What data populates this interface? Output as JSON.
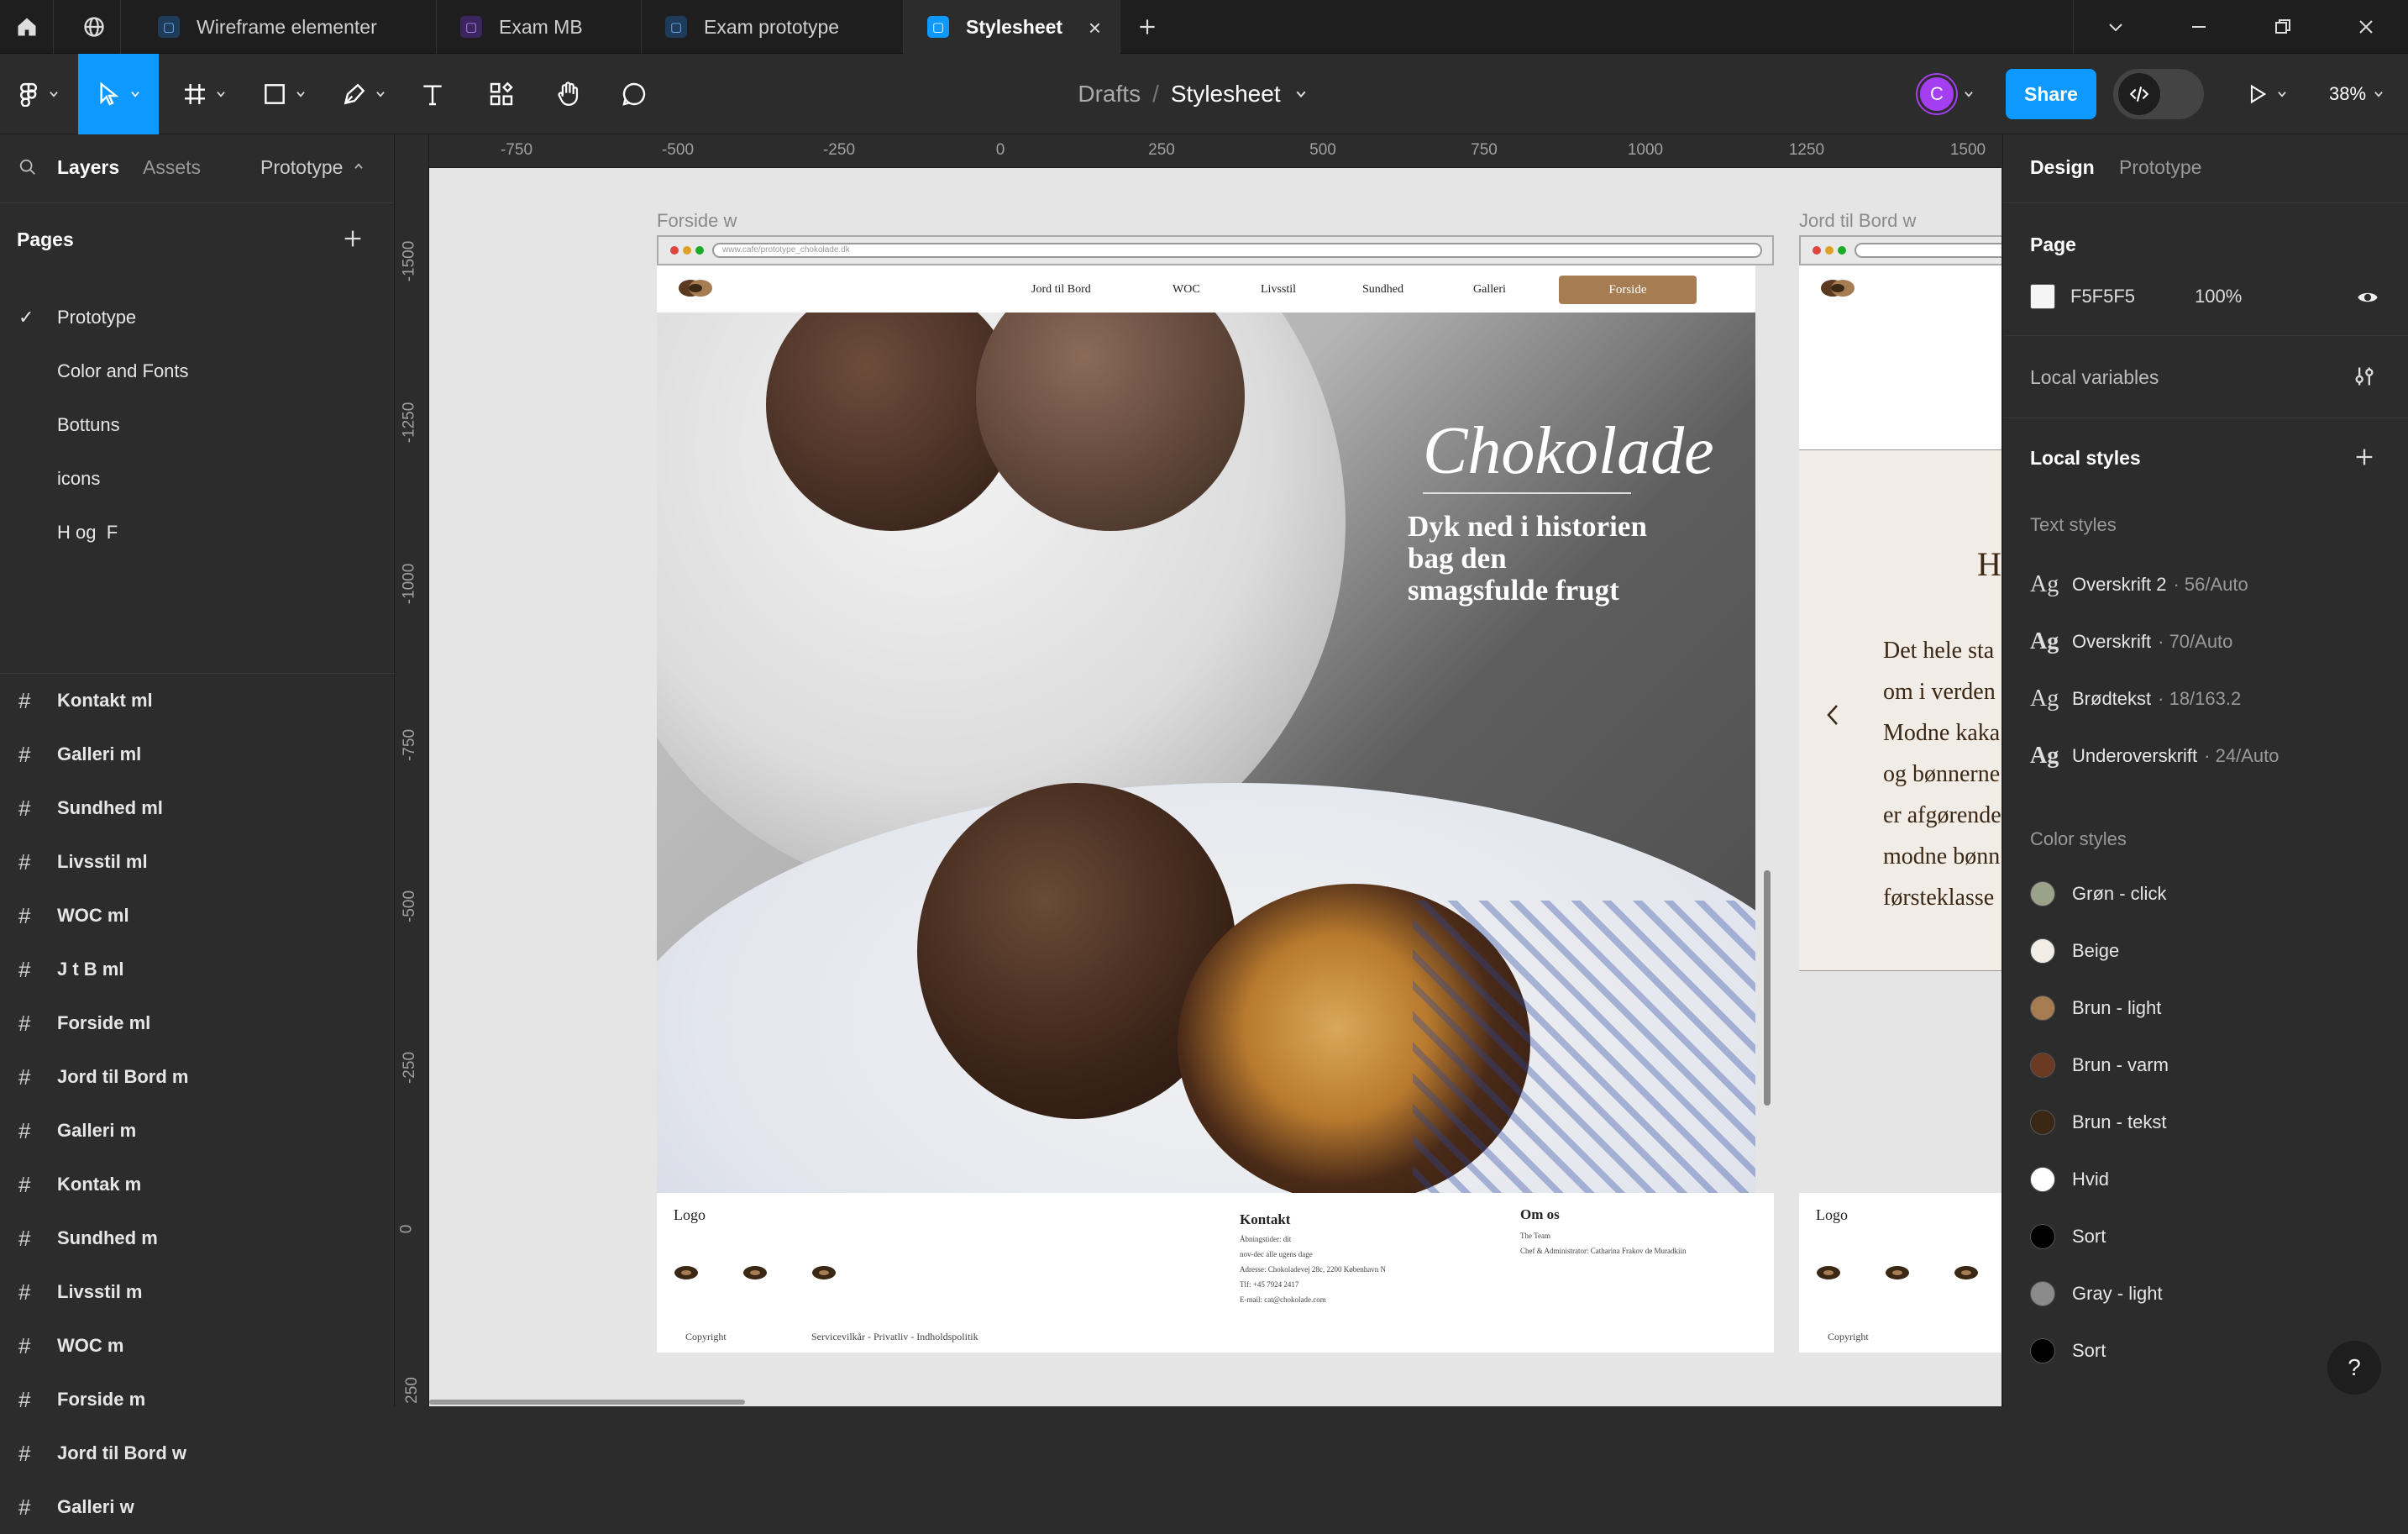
{
  "tabs": [
    {
      "label": "Wireframe elementer",
      "color": "#0d99ff"
    },
    {
      "label": "Exam MB",
      "color": "#9747ff"
    },
    {
      "label": "Exam prototype",
      "color": "#0d99ff"
    },
    {
      "label": "Stylesheet",
      "color": "#0d99ff"
    }
  ],
  "toolbar": {
    "breadcrumb_root": "Drafts",
    "breadcrumb_sep": "/",
    "file_name": "Stylesheet",
    "avatar": "C",
    "share": "Share",
    "zoom": "38%"
  },
  "left": {
    "tab_layers": "Layers",
    "tab_assets": "Assets",
    "tab_prototype": "Prototype",
    "pages_title": "Pages",
    "pages": [
      "Prototype",
      "Color and Fonts",
      "Bottuns",
      "icons",
      "H og  F"
    ],
    "frames": [
      "Kontakt ml",
      "Galleri ml",
      "Sundhed ml",
      "Livsstil ml",
      "WOC ml",
      "J t B ml",
      "Forside ml",
      "Jord til Bord m",
      "Galleri m",
      "Kontak m",
      "Sundhed m",
      "Livsstil m",
      "WOC m",
      "Forside m",
      "Jord til Bord w",
      "Galleri w"
    ]
  },
  "rulers": {
    "top": [
      "-750",
      "-500",
      "-250",
      "0",
      "250",
      "500",
      "750",
      "1000",
      "1250",
      "1500"
    ],
    "left": [
      "-1500",
      "-1250",
      "-1000",
      "-750",
      "-500",
      "-250",
      "0",
      "250"
    ]
  },
  "canvas": {
    "frame1_label": "Forside w",
    "frame2_label": "Jord til Bord w",
    "url": "www.cafe/prototype_chokolade.dk",
    "nav": [
      "Jord til Bord",
      "WOC",
      "Livsstil",
      "Sundhed",
      "Galleri",
      "Forside"
    ],
    "hero_title": "Chokolade",
    "hero_sub_1": "Dyk ned i historien",
    "hero_sub_2": "bag den",
    "hero_sub_3": "smagsfulde frugt",
    "footer": {
      "logo": "Logo",
      "kontakt_title": "Kontakt",
      "kontakt_lines": [
        "Åbningstider: dit",
        "nov-dec alle ugens dage",
        "Adresse: Chokoladevej 28c, 2200 København N",
        "Tlf: +45 7924 2417",
        "E-mail: cat@chokolade.com"
      ],
      "om_title": "Om os",
      "om_lines": [
        "The Team",
        "Chef & Administrator: Catharina Frakov de Muradkiin"
      ],
      "copyright": "Copyright",
      "links": "Servicevilkår - Privatliv - Indholdspolitik"
    },
    "frame2_text": [
      "H",
      "Det hele sta",
      "om i verden",
      "Modne kaka",
      "og bønnerne",
      "er afgørende",
      "modne bønn",
      "førsteklasse"
    ]
  },
  "right": {
    "tab_design": "Design",
    "tab_prototype": "Prototype",
    "page_title": "Page",
    "page_color": "F5F5F5",
    "page_opacity": "100%",
    "local_variables": "Local variables",
    "local_styles": "Local styles",
    "text_styles_title": "Text styles",
    "text_styles": [
      {
        "name": "Overskrift 2",
        "meta": "· 56/Auto"
      },
      {
        "name": "Overskrift",
        "meta": "· 70/Auto"
      },
      {
        "name": "Brødtekst",
        "meta": "· 18/163.2"
      },
      {
        "name": "Underoverskrift",
        "meta": "· 24/Auto"
      }
    ],
    "color_styles_title": "Color styles",
    "color_styles": [
      {
        "name": "Grøn - click",
        "color": "#9aa38a"
      },
      {
        "name": "Beige",
        "color": "#f1ede6"
      },
      {
        "name": "Brun - light",
        "color": "#a67c52"
      },
      {
        "name": "Brun - varm",
        "color": "#6b3a22"
      },
      {
        "name": "Brun - tekst",
        "color": "#3a2714"
      },
      {
        "name": "Hvid",
        "color": "#ffffff"
      },
      {
        "name": "Sort",
        "color": "#000000"
      },
      {
        "name": "Gray - light",
        "color": "#8a8a8a"
      },
      {
        "name": "Sort",
        "color": "#000000"
      }
    ]
  },
  "help": "?"
}
